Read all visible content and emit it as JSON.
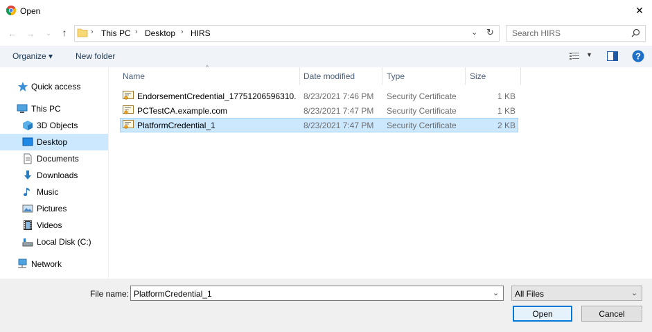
{
  "window": {
    "title": "Open",
    "close_glyph": "✕"
  },
  "nav": {
    "breadcrumb": [
      "This PC",
      "Desktop",
      "HIRS"
    ],
    "search_placeholder": "Search HIRS"
  },
  "toolbar": {
    "organize_label": "Organize ▾",
    "new_folder_label": "New folder"
  },
  "sidebar": {
    "items": [
      {
        "label": "Quick access",
        "icon": "star-icon"
      },
      {
        "label": "This PC",
        "icon": "computer-icon"
      },
      {
        "label": "3D Objects",
        "icon": "3d-objects-icon"
      },
      {
        "label": "Desktop",
        "icon": "desktop-icon",
        "selected": true
      },
      {
        "label": "Documents",
        "icon": "documents-icon"
      },
      {
        "label": "Downloads",
        "icon": "downloads-icon"
      },
      {
        "label": "Music",
        "icon": "music-icon"
      },
      {
        "label": "Pictures",
        "icon": "pictures-icon"
      },
      {
        "label": "Videos",
        "icon": "videos-icon"
      },
      {
        "label": "Local Disk (C:)",
        "icon": "local-disk-icon"
      },
      {
        "label": "Network",
        "icon": "network-icon"
      }
    ]
  },
  "table": {
    "headers": {
      "name": "Name",
      "date": "Date modified",
      "type": "Type",
      "size": "Size"
    },
    "rows": [
      {
        "name": "EndorsementCredential_17751206596310...",
        "date": "8/23/2021 7:46 PM",
        "type": "Security Certificate",
        "size": "1 KB"
      },
      {
        "name": "PCTestCA.example.com",
        "date": "8/23/2021 7:47 PM",
        "type": "Security Certificate",
        "size": "1 KB"
      },
      {
        "name": "PlatformCredential_1",
        "date": "8/23/2021 7:47 PM",
        "type": "Security Certificate",
        "size": "2 KB",
        "selected": true
      }
    ]
  },
  "bottom": {
    "filename_label": "File name:",
    "filename_value": "PlatformCredential_1",
    "filetype_value": "All Files",
    "open_label": "Open",
    "cancel_label": "Cancel"
  },
  "colors": {
    "accent": "#0078d7",
    "selection": "#cce8ff",
    "toolbar_bg": "#f0f4f9"
  }
}
